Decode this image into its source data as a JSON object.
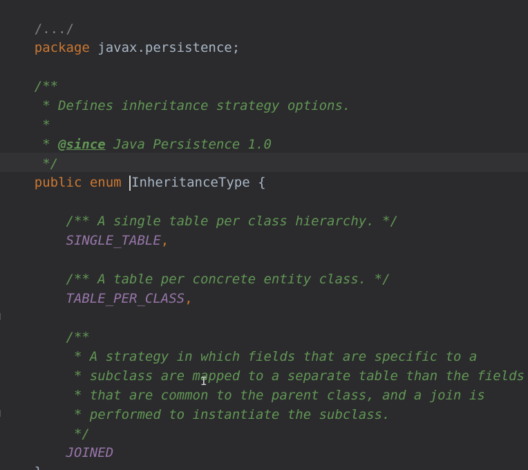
{
  "editor": {
    "lines": {
      "folded_imports": "/.../",
      "package_kw": "package",
      "package_name": " javax.persistence;",
      "doc_open": "/**",
      "doc_desc": " * Defines inheritance strategy options.",
      "doc_blank": " *",
      "doc_since_prefix": " * ",
      "doc_since_tag": "@since",
      "doc_since_text": " Java Persistence 1.0",
      "doc_close": " */",
      "public_kw": "public",
      "enum_kw": " enum ",
      "enum_name": "InheritanceType",
      "enum_open": " {",
      "single_doc": "    /** A single table per class hierarchy. */",
      "single_const": "    SINGLE_TABLE",
      "single_comma": ",",
      "tpc_doc": "    /** A table per concrete entity class. */",
      "tpc_const": "    TABLE_PER_CLASS",
      "tpc_comma": ",",
      "joined_doc_open": "    /**",
      "joined_doc_1": "     * A strategy in which fields that are specific to a",
      "joined_doc_2": "     * subclass are mapped to a separate table than the fields",
      "joined_doc_3": "     * that are common to the parent class, and a join is",
      "joined_doc_4": "     * performed to instantiate the subclass.",
      "joined_doc_close": "     */",
      "joined_const": "    JOINED",
      "close_brace": "}"
    },
    "mouse_cursor_glyph": "I",
    "colors": {
      "background": "#2b2b2d",
      "keyword": "#cc7832",
      "identifier": "#a9b7c6",
      "doc_comment": "#629755",
      "enum_constant": "#9876aa",
      "caret_line": "#323234"
    }
  }
}
